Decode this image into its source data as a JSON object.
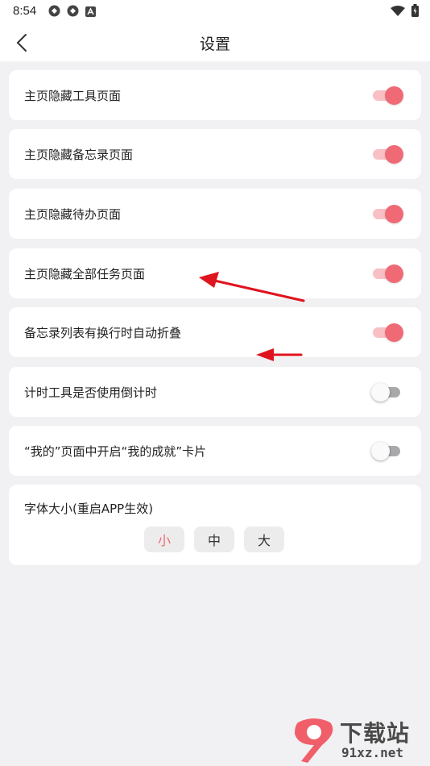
{
  "status_bar": {
    "time": "8:54",
    "left_icons": [
      "app-icon",
      "app-icon",
      "a-icon"
    ],
    "right_icons": [
      "wifi-icon",
      "battery-icon"
    ]
  },
  "header": {
    "title": "设置",
    "back_icon": "chevron-left-icon"
  },
  "settings": [
    {
      "label": "主页隐藏工具页面",
      "enabled": true
    },
    {
      "label": "主页隐藏备忘录页面",
      "enabled": true
    },
    {
      "label": "主页隐藏待办页面",
      "enabled": true
    },
    {
      "label": "主页隐藏全部任务页面",
      "enabled": true
    },
    {
      "label": "备忘录列表有换行时自动折叠",
      "enabled": true
    },
    {
      "label": "计时工具是否使用倒计时",
      "enabled": false
    },
    {
      "label": "“我的”页面中开启“我的成就”卡片",
      "enabled": false
    }
  ],
  "font_size": {
    "label": "字体大小(重启APP生效)",
    "options": [
      "小",
      "中",
      "大"
    ],
    "selected": "小"
  },
  "colors": {
    "accent": "#f06a76",
    "annotation_arrow": "#e0141e"
  },
  "watermark": {
    "text": "下载站",
    "url": "91xz.net",
    "logo_text": "9"
  }
}
